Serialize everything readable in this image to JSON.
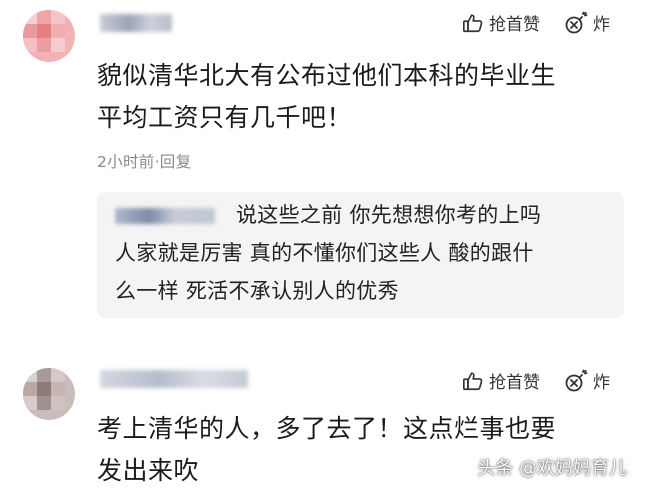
{
  "comments": [
    {
      "text_line1": "貌似清华北大有公布过他们本科的毕业生",
      "text_line2": "平均工资只有几千吧！",
      "time": "2小时前",
      "reply_label": "·回复",
      "like_label": "抢首赞",
      "bomb_label": "炸",
      "reply": {
        "line1": "说这些之前 你先想想你考的上吗",
        "line2": "人家就是厉害 真的不懂你们这些人 酸的跟什",
        "line3": "么一样 死活不承认别人的优秀"
      }
    },
    {
      "text_line1": "考上清华的人，多了去了！这点烂事也要",
      "text_line2": "发出来吹",
      "like_label": "抢首赞",
      "bomb_label": "炸"
    }
  ],
  "watermark": "头条 @欢妈妈育儿",
  "icons": {
    "like": "thumbs-up-icon",
    "bomb": "bomb-icon"
  }
}
